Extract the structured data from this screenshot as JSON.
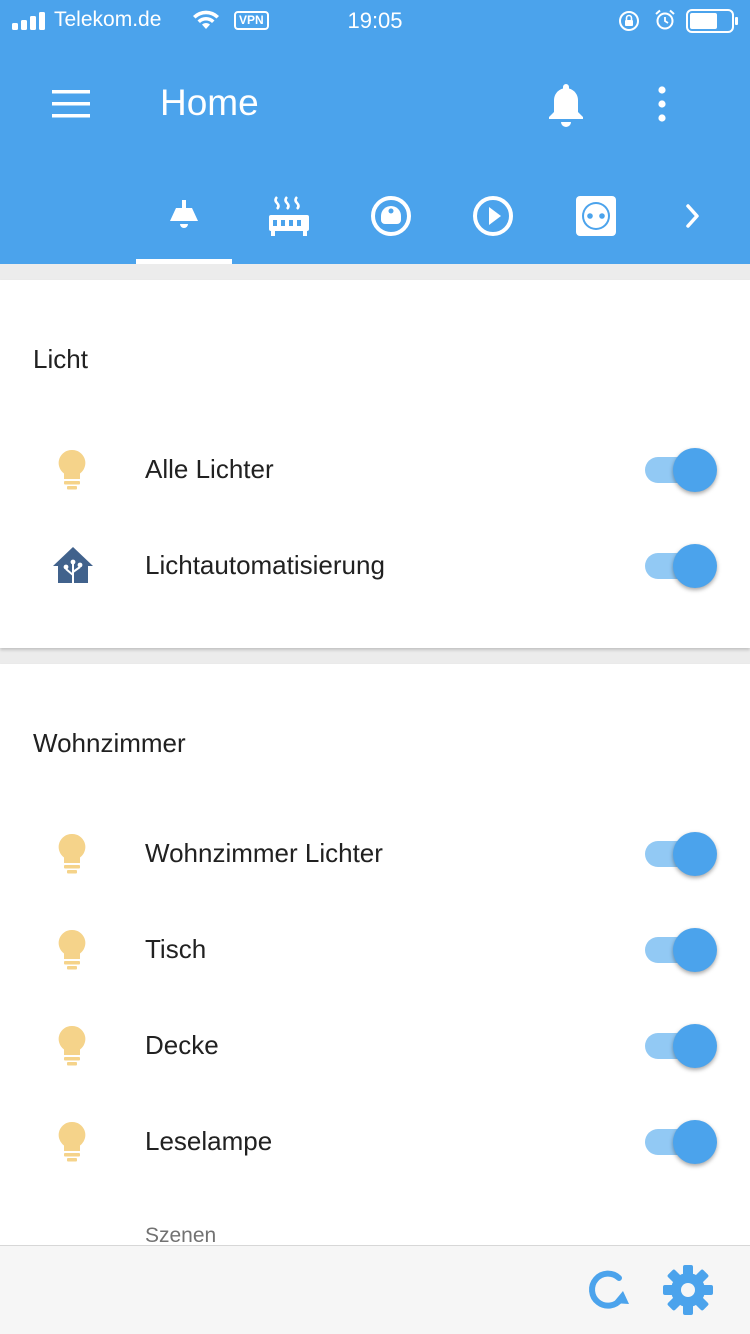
{
  "status_bar": {
    "carrier": "Telekom.de",
    "vpn": "VPN",
    "time": "19:05"
  },
  "header": {
    "title": "Home",
    "menu_icon": "menu-icon",
    "notifications_icon": "bell-icon",
    "more_icon": "more-vert-icon"
  },
  "tabs": [
    {
      "icon": "ceiling-light-icon",
      "selected": true
    },
    {
      "icon": "radiator-icon",
      "selected": false
    },
    {
      "icon": "robot-vacuum-icon",
      "selected": false
    },
    {
      "icon": "play-circle-icon",
      "selected": false
    },
    {
      "icon": "power-socket-icon",
      "selected": false
    },
    {
      "icon": "chevron-right-icon",
      "selected": false
    }
  ],
  "cards": [
    {
      "title": "Licht",
      "rows": [
        {
          "label": "Alle Lichter",
          "icon": "lightbulb-icon",
          "on": true
        },
        {
          "label": "Lichtautomatisierung",
          "icon": "home-assistant-icon",
          "on": true
        }
      ]
    },
    {
      "title": "Wohnzimmer",
      "rows": [
        {
          "label": "Wohnzimmer Lichter",
          "icon": "lightbulb-icon",
          "on": true
        },
        {
          "label": "Tisch",
          "icon": "lightbulb-icon",
          "on": true
        },
        {
          "label": "Decke",
          "icon": "lightbulb-icon",
          "on": true
        },
        {
          "label": "Leselampe",
          "icon": "lightbulb-icon",
          "on": true
        }
      ],
      "subheader": "Szenen"
    }
  ],
  "bottom_bar": {
    "refresh_icon": "refresh-icon",
    "settings_icon": "gear-icon"
  },
  "colors": {
    "primary": "#4ba3ec",
    "toggle_track": "#92c9f4",
    "bulb": "#f5d38a",
    "ha_icon": "#41628c"
  }
}
